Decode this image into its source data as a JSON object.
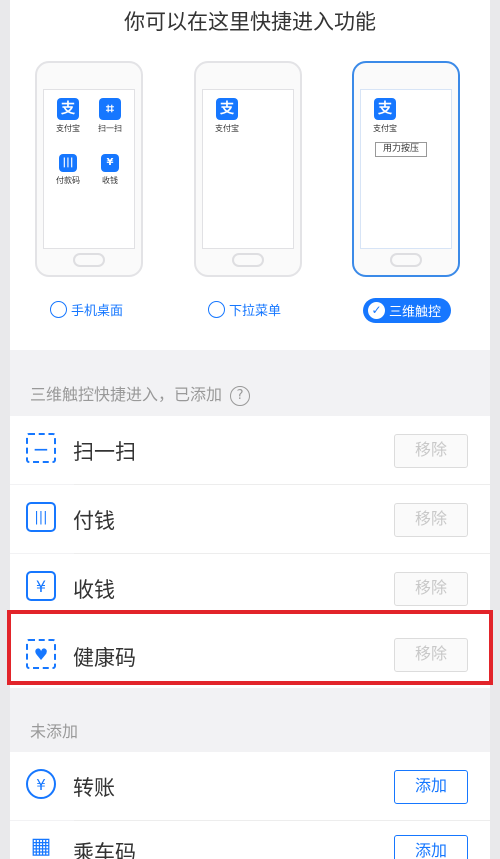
{
  "headline": "你可以在这里快捷进入功能",
  "modes": {
    "desktop": {
      "label": "手机桌面",
      "apps": [
        "支付宝",
        "扫一扫",
        "付款码",
        "收钱"
      ]
    },
    "dropdown": {
      "label": "下拉菜单",
      "apps": [
        "支付宝"
      ]
    },
    "touch3d": {
      "label": "三维触控",
      "apps": [
        "支付宝"
      ],
      "press_label": "用力按压",
      "selected": true
    }
  },
  "added_section": {
    "title": "三维触控快捷进入，已添加",
    "help": "?",
    "items": [
      {
        "name": "扫一扫",
        "button": "移除"
      },
      {
        "name": "付钱",
        "button": "移除"
      },
      {
        "name": "收钱",
        "button": "移除"
      },
      {
        "name": "健康码",
        "button": "移除"
      }
    ]
  },
  "not_added_section": {
    "title": "未添加",
    "items": [
      {
        "name": "转账",
        "button": "添加"
      },
      {
        "name": "乘车码",
        "button": "添加"
      }
    ]
  },
  "icons": {
    "alipay": "alipay-icon",
    "scan": "scan-icon",
    "pay": "barcode-icon",
    "collect": "yuan-icon",
    "health": "health-code-icon",
    "transfer": "transfer-icon",
    "transit": "qr-code-icon"
  },
  "colors": {
    "accent": "#1677ff",
    "highlight": "#e2242a"
  }
}
